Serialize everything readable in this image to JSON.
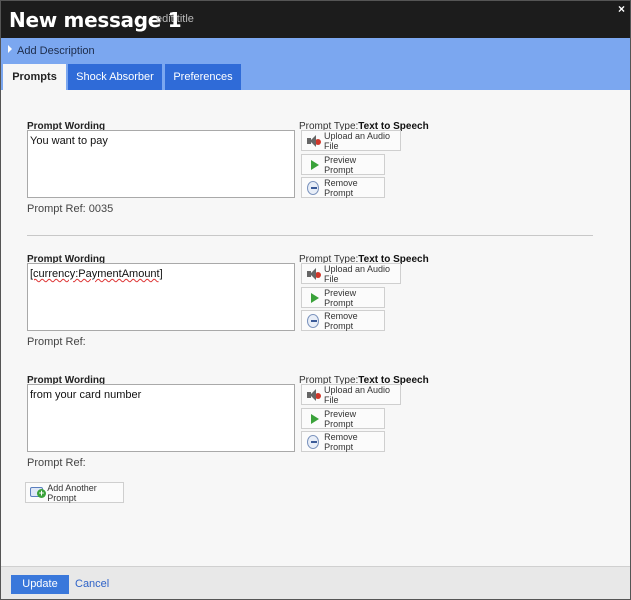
{
  "window": {
    "title": "New message 1",
    "edit_title": "edit title",
    "close": "×"
  },
  "description": {
    "label": "Add Description"
  },
  "tabs": [
    {
      "label": "Prompts",
      "active": true
    },
    {
      "label": "Shock Absorber",
      "active": false
    },
    {
      "label": "Preferences",
      "active": false
    }
  ],
  "prompts": [
    {
      "wording_label": "Prompt Wording",
      "text": "You want to pay",
      "ref_label": "Prompt Ref: 0035",
      "type_label": "Prompt Type:",
      "type_value": "Text to Speech",
      "upload_label": "Upload an Audio File",
      "preview_label": "Preview Prompt",
      "remove_label": "Remove Prompt"
    },
    {
      "wording_label": "Prompt Wording",
      "text": "[currency:PaymentAmount]",
      "ref_label": "Prompt Ref:",
      "type_label": "Prompt Type:",
      "type_value": "Text to Speech",
      "upload_label": "Upload an Audio File",
      "preview_label": "Preview Prompt",
      "remove_label": "Remove Prompt"
    },
    {
      "wording_label": "Prompt Wording",
      "text": "from your card number",
      "ref_label": "Prompt Ref:",
      "type_label": "Prompt Type:",
      "type_value": "Text to Speech",
      "upload_label": "Upload an Audio File",
      "preview_label": "Preview Prompt",
      "remove_label": "Remove Prompt"
    }
  ],
  "add_prompt_label": "Add Another Prompt",
  "footer": {
    "update_label": "Update",
    "cancel_label": "Cancel"
  },
  "colors": {
    "titlebar": "#1c1c1c",
    "description_bar": "#7ba7f0",
    "tab_inactive": "#2f6bd8",
    "update_button": "#3a78db",
    "play_icon": "#3aa23a",
    "speaker_badge": "#d0372a"
  },
  "icons": [
    "close-icon",
    "caret-right-icon",
    "speaker-icon",
    "play-icon",
    "remove-icon",
    "add-prompt-icon"
  ]
}
